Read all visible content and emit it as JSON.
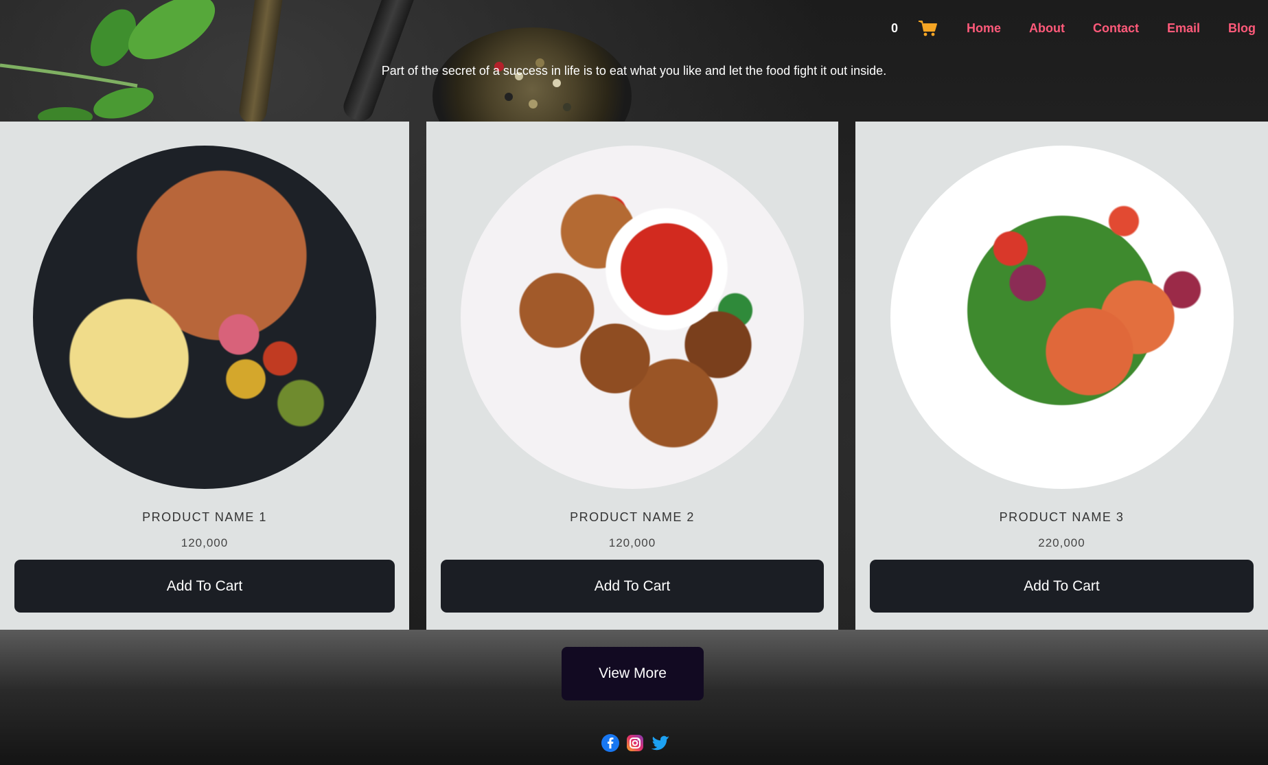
{
  "header": {
    "cart_count": "0",
    "cart_icon": "cart-icon",
    "nav": [
      "Home",
      "About",
      "Contact",
      "Email",
      "Blog"
    ],
    "tagline": "Part of the secret of a success in life is to eat what you like and let the food fight it out inside."
  },
  "products": [
    {
      "name": "PRODUCT NAME 1",
      "price": "120,000",
      "button": "Add To Cart",
      "image": "pulled-pork-corn-vegetables-plate"
    },
    {
      "name": "PRODUCT NAME 2",
      "price": "120,000",
      "button": "Add To Cart",
      "image": "grilled-chicken-wings-with-salsa"
    },
    {
      "name": "PRODUCT NAME 3",
      "price": "220,000",
      "button": "Add To Cart",
      "image": "salmon-salad-plate"
    }
  ],
  "view_more": "View More",
  "social": [
    "facebook-icon",
    "instagram-icon",
    "twitter-icon"
  ],
  "colors": {
    "nav_link": "#ff5a7a",
    "card_bg": "#dfe2e2",
    "button_bg": "#1b1e24",
    "view_more_bg": "#120a22",
    "cart_icon": "#f5a524"
  }
}
